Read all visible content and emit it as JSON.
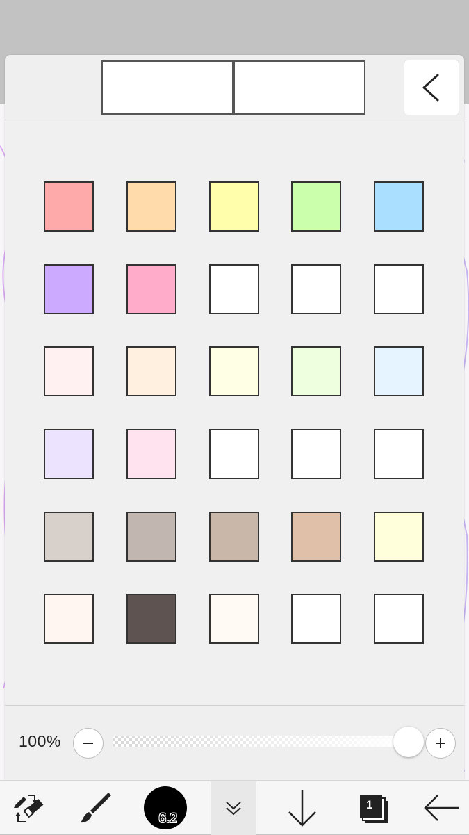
{
  "panel": {
    "tabs": [
      "",
      ""
    ]
  },
  "palette": {
    "rows": [
      [
        "#ffaaaa",
        "#ffdbab",
        "#ffffab",
        "#ccffab",
        "#abdfff"
      ],
      [
        "#ccaaff",
        "#ffabca",
        "#ffffff",
        "#ffffff",
        "#ffffff"
      ],
      [
        "#fff1f1",
        "#fff0e0",
        "#ffffe5",
        "#eeffe0",
        "#e5f4ff"
      ],
      [
        "#ece3ff",
        "#ffe4ef",
        "#ffffff",
        "#ffffff",
        "#ffffff"
      ],
      [
        "#d8d0cb",
        "#c2b7b0",
        "#c9b8aa",
        "#e0c0a8",
        "#ffffdb"
      ],
      [
        "#fff6f1",
        "#5e5350",
        "#fffbf4",
        "#ffffff",
        "#ffffff"
      ]
    ]
  },
  "zoom": {
    "label": "100%",
    "level_fraction": 1.0
  },
  "toolbar": {
    "brush_size": "6.2",
    "layer_count": "1"
  }
}
